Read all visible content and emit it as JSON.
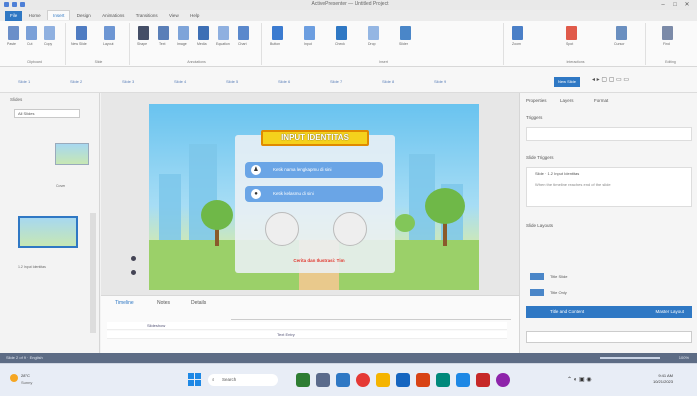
{
  "window": {
    "title": "ActivePresenter — Untitled Project"
  },
  "ribbon_tabs": [
    "File",
    "Home",
    "Insert",
    "Design",
    "Animations",
    "Transitions",
    "View",
    "Help"
  ],
  "ribbon_groups": [
    {
      "name": "Clipboard",
      "buttons": [
        "Paste",
        "Cut",
        "Copy"
      ]
    },
    {
      "name": "Slide",
      "buttons": [
        "New Slide",
        "Layout"
      ]
    },
    {
      "name": "Annotations",
      "buttons": [
        "Shape",
        "Text",
        "Image",
        "Media",
        "Equation",
        "Chart"
      ]
    },
    {
      "name": "Insert",
      "buttons": [
        "Button",
        "Input",
        "Check",
        "Drop",
        "Slider"
      ]
    },
    {
      "name": "Interactions",
      "buttons": [
        "Zoom",
        "Spot",
        "Cursor"
      ]
    },
    {
      "name": "Editing",
      "buttons": [
        "Find"
      ]
    }
  ],
  "toolbar2": {
    "items": [
      "Slide 1",
      "Slide 2",
      "Slide 3",
      "Slide 4",
      "Slide 5",
      "Slide 6",
      "Slide 7",
      "Slide 8",
      "Slide 9"
    ],
    "new_slide": "New Slide"
  },
  "left_panel": {
    "title": "Slides",
    "filter": "All Slides",
    "thumb1_caption": "Cover",
    "thumb2_caption": "1.2 Input Identitas"
  },
  "slide": {
    "title": "INPUT IDENTITAS",
    "field1": "Ketik nama lengkapmu di sini",
    "field2": "Ketik kelasmu di sini",
    "field1_icon": "user-icon",
    "field2_icon": "group-icon",
    "credit": "Cerita dan Ilustrasi: Tim",
    "colors": {
      "title_bg": "#f5d11c",
      "field_bg": "#6aa5e6",
      "credit": "#e0342b"
    }
  },
  "timeline": {
    "tabs": [
      "Timeline",
      "Notes",
      "Details"
    ],
    "active_tab": "Timeline",
    "rows": [
      "Slideshow",
      "Text Entry"
    ]
  },
  "right_panel": {
    "tabs": [
      "Properties",
      "Layers",
      "Format"
    ],
    "triggers_title": "Triggers",
    "slide_triggers_title": "Slide Triggers",
    "trigger_item": "Slide · 1.2 Input Identitas",
    "trigger_detail": "When the timeline reaches end of the slide",
    "layouts_title": "Slide Layouts",
    "layouts": [
      "Title Slide",
      "Title Only",
      "Blank"
    ],
    "selected_layout": "Title and Content",
    "selected_layout_right": "Master Layout"
  },
  "status_bar": {
    "left": "Slide 2 of 9 · English",
    "right": "100%"
  },
  "taskbar": {
    "weather_temp": "28°C",
    "weather_desc": "Sunny",
    "search": "Search",
    "time": "9:41 AM",
    "date": "10/21/2023"
  }
}
